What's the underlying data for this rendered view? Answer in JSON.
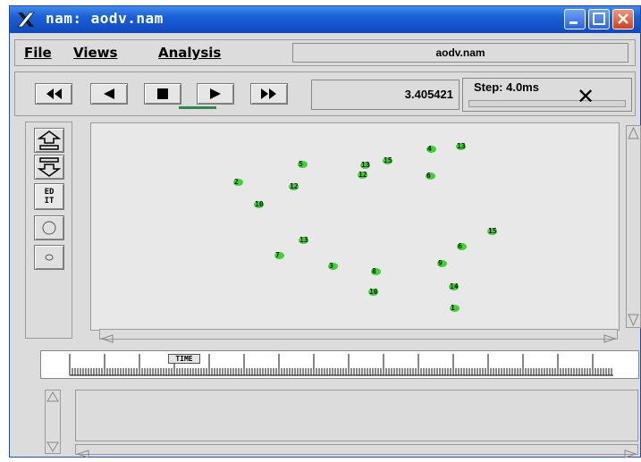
{
  "window": {
    "title": "nam: aodv.nam"
  },
  "menu": {
    "file": "File",
    "views": "Views",
    "analysis": "Analysis"
  },
  "trace_file": "aodv.nam",
  "playback": {
    "current_time": "3.405421",
    "step_label": "Step: 4.0ms"
  },
  "tools": {
    "edit_label_top": "ED",
    "edit_label_bottom": "IT"
  },
  "timeline": {
    "time_marker_label": "TIME"
  },
  "colors": {
    "node": "#3cd42e",
    "titlebar": "#1a5fd6",
    "play_indicator": "#2e8a4a"
  },
  "nodes": [
    {
      "label": "2"
    },
    {
      "label": "5"
    },
    {
      "label": "12"
    },
    {
      "label": "10"
    },
    {
      "label": "13"
    },
    {
      "label": "12"
    },
    {
      "label": "15"
    },
    {
      "label": "4"
    },
    {
      "label": "13"
    },
    {
      "label": "6"
    },
    {
      "label": "13"
    },
    {
      "label": "7"
    },
    {
      "label": "3"
    },
    {
      "label": "8"
    },
    {
      "label": "10"
    },
    {
      "label": "9"
    },
    {
      "label": "6"
    },
    {
      "label": "15"
    },
    {
      "label": "14"
    },
    {
      "label": "1"
    }
  ]
}
